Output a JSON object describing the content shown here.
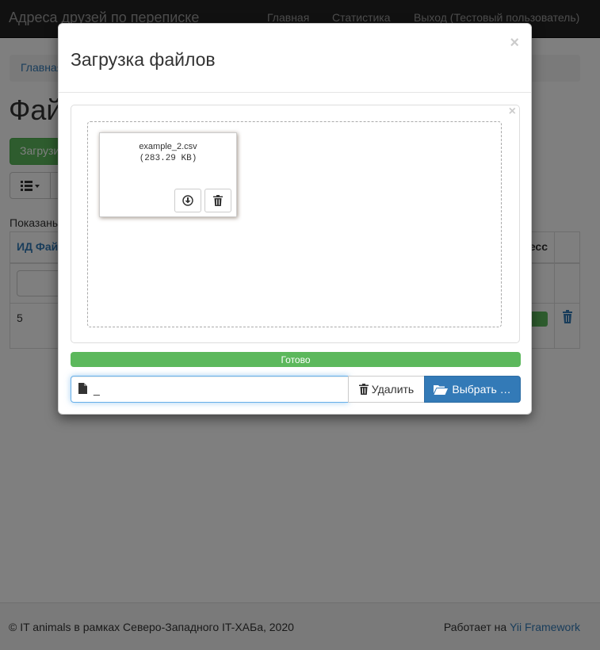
{
  "navbar": {
    "brand": "Адреса друзей по переписке",
    "links": [
      "Главная",
      "Статистика",
      "Выход (Тестовый пользователь)"
    ]
  },
  "background": {
    "breadcrumb": "Главная",
    "heading": "Фай",
    "upload_button": "Загрузи",
    "summary": "Показаны",
    "table": {
      "col_id": "ИД Фай",
      "col_progress": "есс",
      "row_id": "5"
    }
  },
  "modal": {
    "title": "Загрузка файлов",
    "close": "×",
    "preview_close": "×",
    "file": {
      "name": "example_2.csv",
      "size": "(283.29 KB)"
    },
    "progress": {
      "label": "Готово",
      "percent": 100
    },
    "caption": "_",
    "remove_label": "Удалить",
    "browse_label": "Выбрать …"
  },
  "footer": {
    "copyright": "© IT animals в рамках Северо-Западного IT-ХАБа, 2020",
    "powered_prefix": "Работает на ",
    "powered_link": "Yii Framework"
  },
  "colors": {
    "navbar": "#222222",
    "primary": "#337ab7",
    "success": "#5cb85c"
  }
}
